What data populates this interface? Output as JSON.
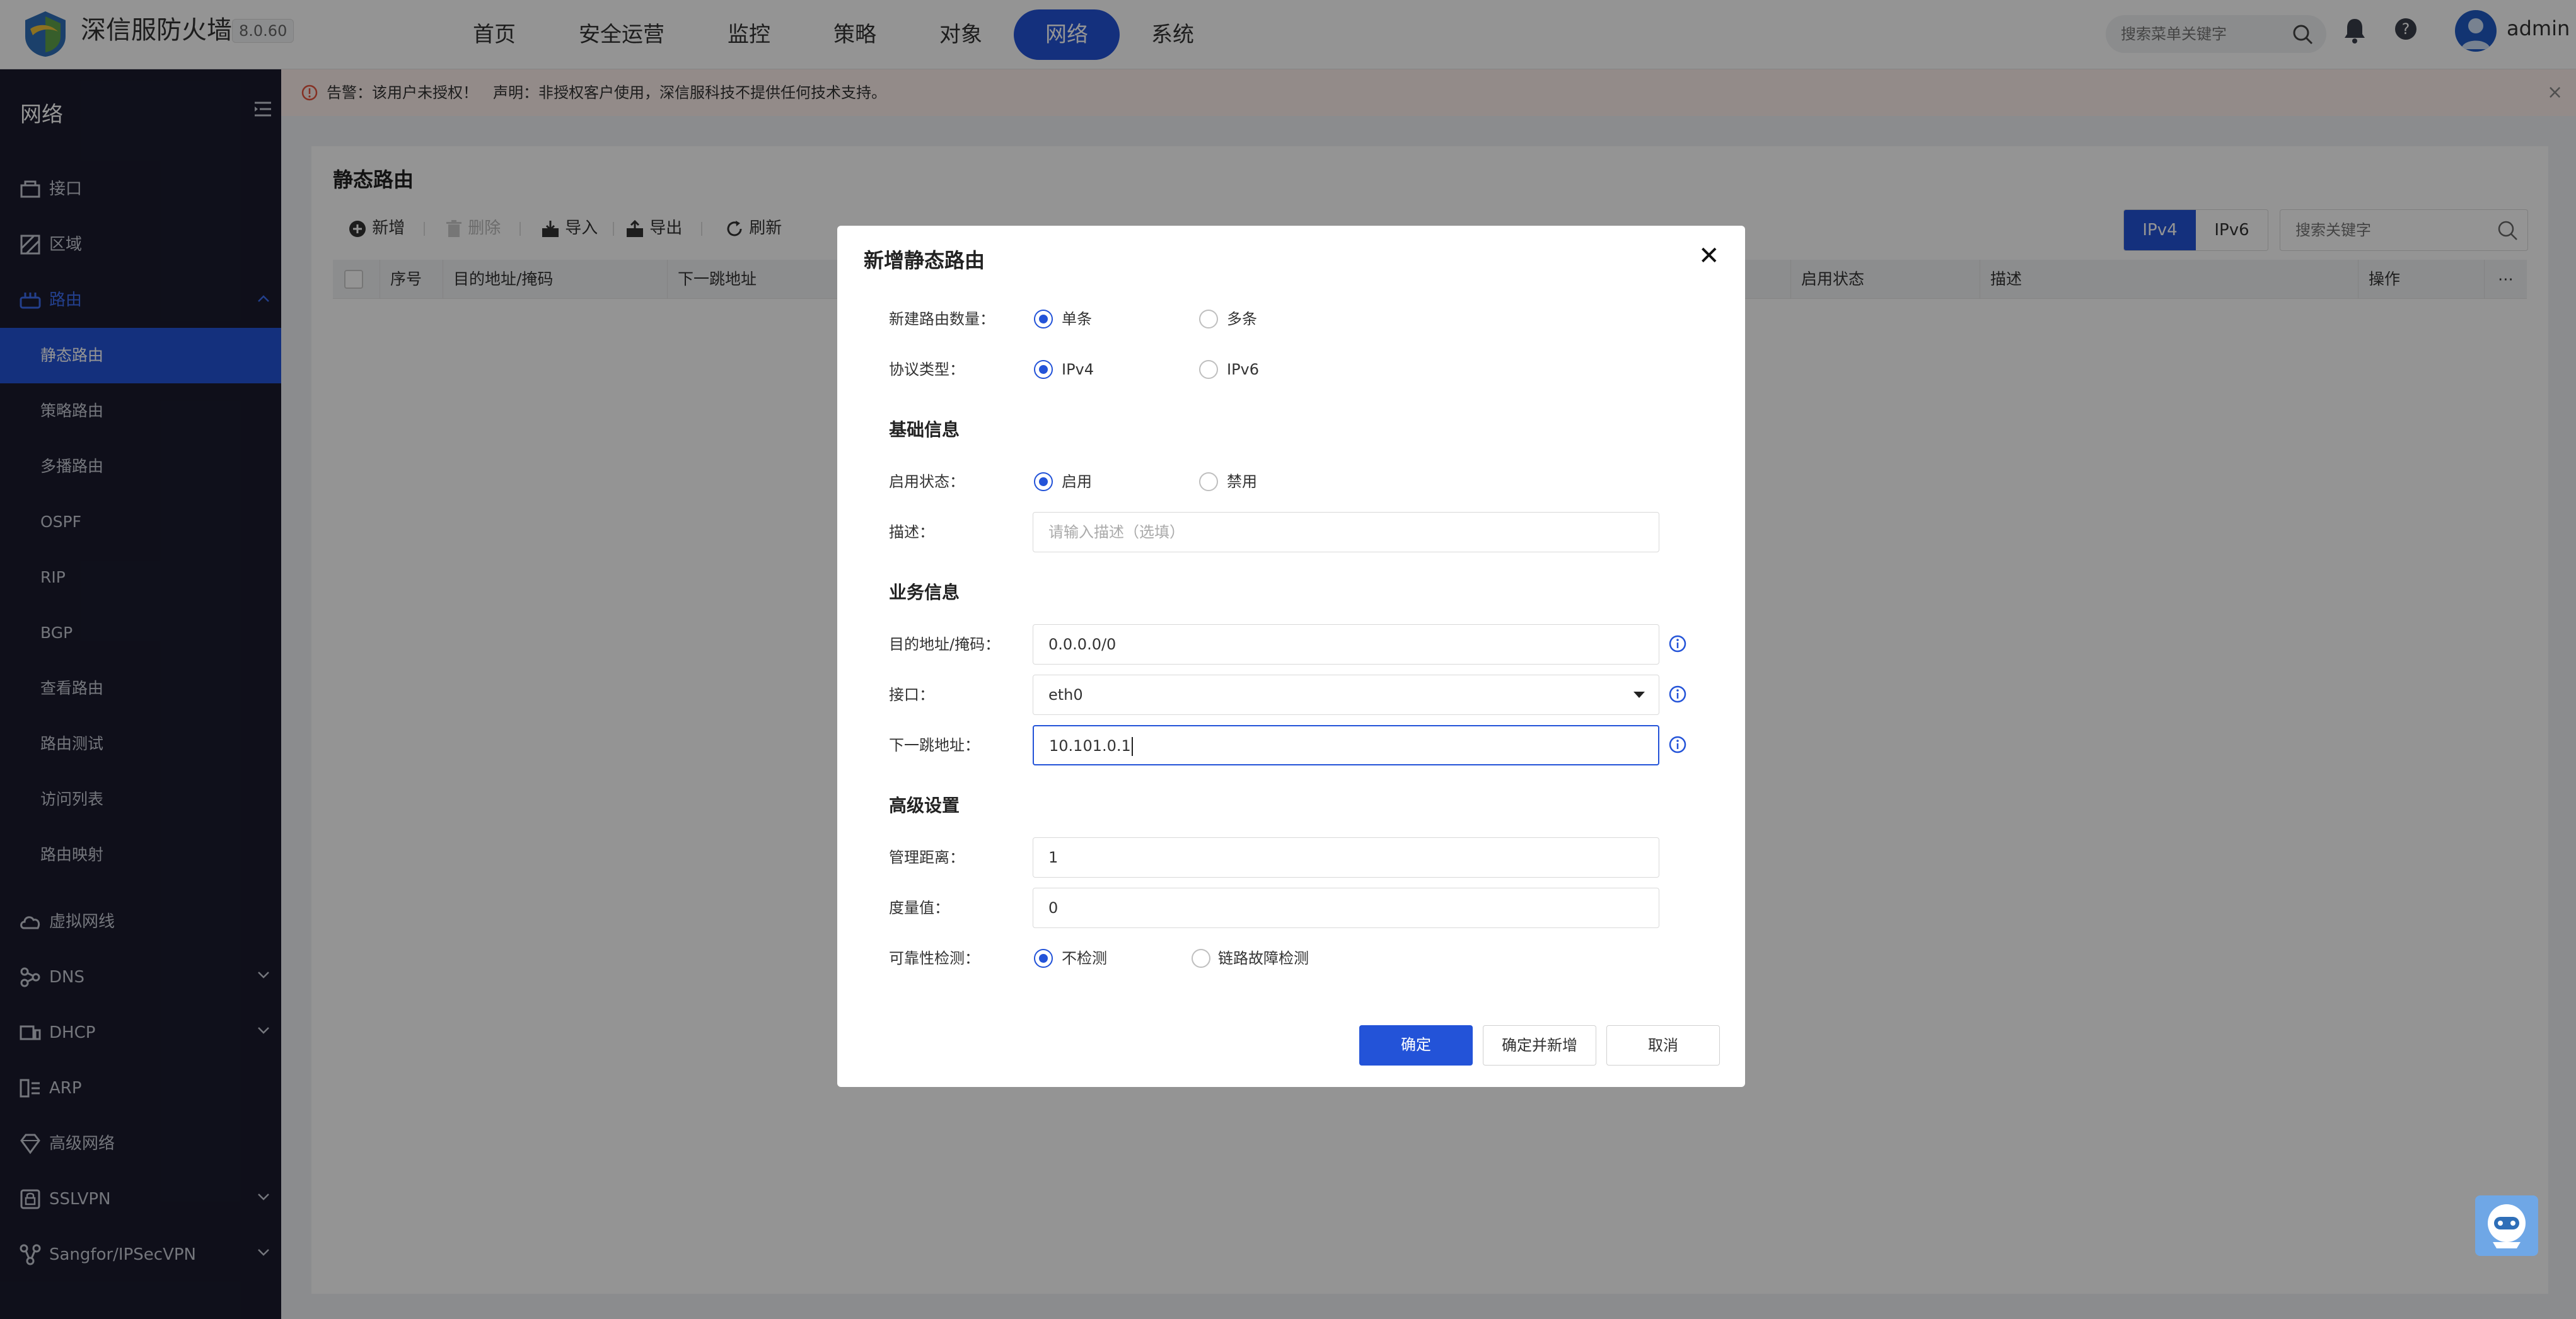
{
  "app": {
    "brand": "深信服防火墙",
    "version": "8.0.60",
    "user": "admin",
    "search_placeholder": "搜索菜单关键字"
  },
  "nav": [
    {
      "label": "首页"
    },
    {
      "label": "安全运营"
    },
    {
      "label": "监控"
    },
    {
      "label": "策略"
    },
    {
      "label": "对象"
    },
    {
      "label": "网络",
      "active": true
    },
    {
      "label": "系统"
    }
  ],
  "sidebar": {
    "title": "网络",
    "items": [
      {
        "label": "接口"
      },
      {
        "label": "区域"
      },
      {
        "label": "路由"
      },
      {
        "label": "静态路由"
      },
      {
        "label": "策略路由"
      },
      {
        "label": "多播路由"
      },
      {
        "label": "OSPF"
      },
      {
        "label": "RIP"
      },
      {
        "label": "BGP"
      },
      {
        "label": "查看路由"
      },
      {
        "label": "路由测试"
      },
      {
        "label": "访问列表"
      },
      {
        "label": "路由映射"
      },
      {
        "label": "虚拟网线"
      },
      {
        "label": "DNS"
      },
      {
        "label": "DHCP"
      },
      {
        "label": "ARP"
      },
      {
        "label": "高级网络"
      },
      {
        "label": "SSLVPN"
      },
      {
        "label": "Sangfor/IPSecVPN"
      }
    ]
  },
  "warning": {
    "text1": "告警：该用户未授权！",
    "text2": "声明：非授权客户使用，深信服科技不提供任何技术支持。"
  },
  "page": {
    "title": "静态路由",
    "toolbar": {
      "add": "新增",
      "delete": "删除",
      "import": "导入",
      "export": "导出",
      "refresh": "刷新",
      "ipv4": "IPv4",
      "ipv6": "IPv6",
      "search_placeholder": "搜索关键字"
    },
    "columns": [
      "序号",
      "目的地址/掩码",
      "下一跳地址",
      "启用状态",
      "描述",
      "操作"
    ]
  },
  "modal": {
    "title": "新增静态路由",
    "route_count_label": "新建路由数量：",
    "route_count_options": [
      "单条",
      "多条"
    ],
    "protocol_label": "协议类型：",
    "protocol_options": [
      "IPv4",
      "IPv6"
    ],
    "section_basic": "基础信息",
    "status_label": "启用状态：",
    "status_options": [
      "启用",
      "禁用"
    ],
    "desc_label": "描述：",
    "desc_placeholder": "请输入描述（选填）",
    "section_business": "业务信息",
    "dest_label": "目的地址/掩码：",
    "dest_value": "0.0.0.0/0",
    "iface_label": "接口：",
    "iface_value": "eth0",
    "nexthop_label": "下一跳地址：",
    "nexthop_value": "10.101.0.1",
    "section_advanced": "高级设置",
    "distance_label": "管理距离：",
    "distance_value": "1",
    "metric_label": "度量值：",
    "metric_value": "0",
    "reliability_label": "可靠性检测：",
    "reliability_options": [
      "不检测",
      "链路故障检测"
    ],
    "btn_ok": "确定",
    "btn_ok_add": "确定并新增",
    "btn_cancel": "取消"
  },
  "colors": {
    "primary": "#2353d8",
    "sidebar_bg": "#1a1b2e",
    "warning_bg": "#fdf0ec"
  }
}
